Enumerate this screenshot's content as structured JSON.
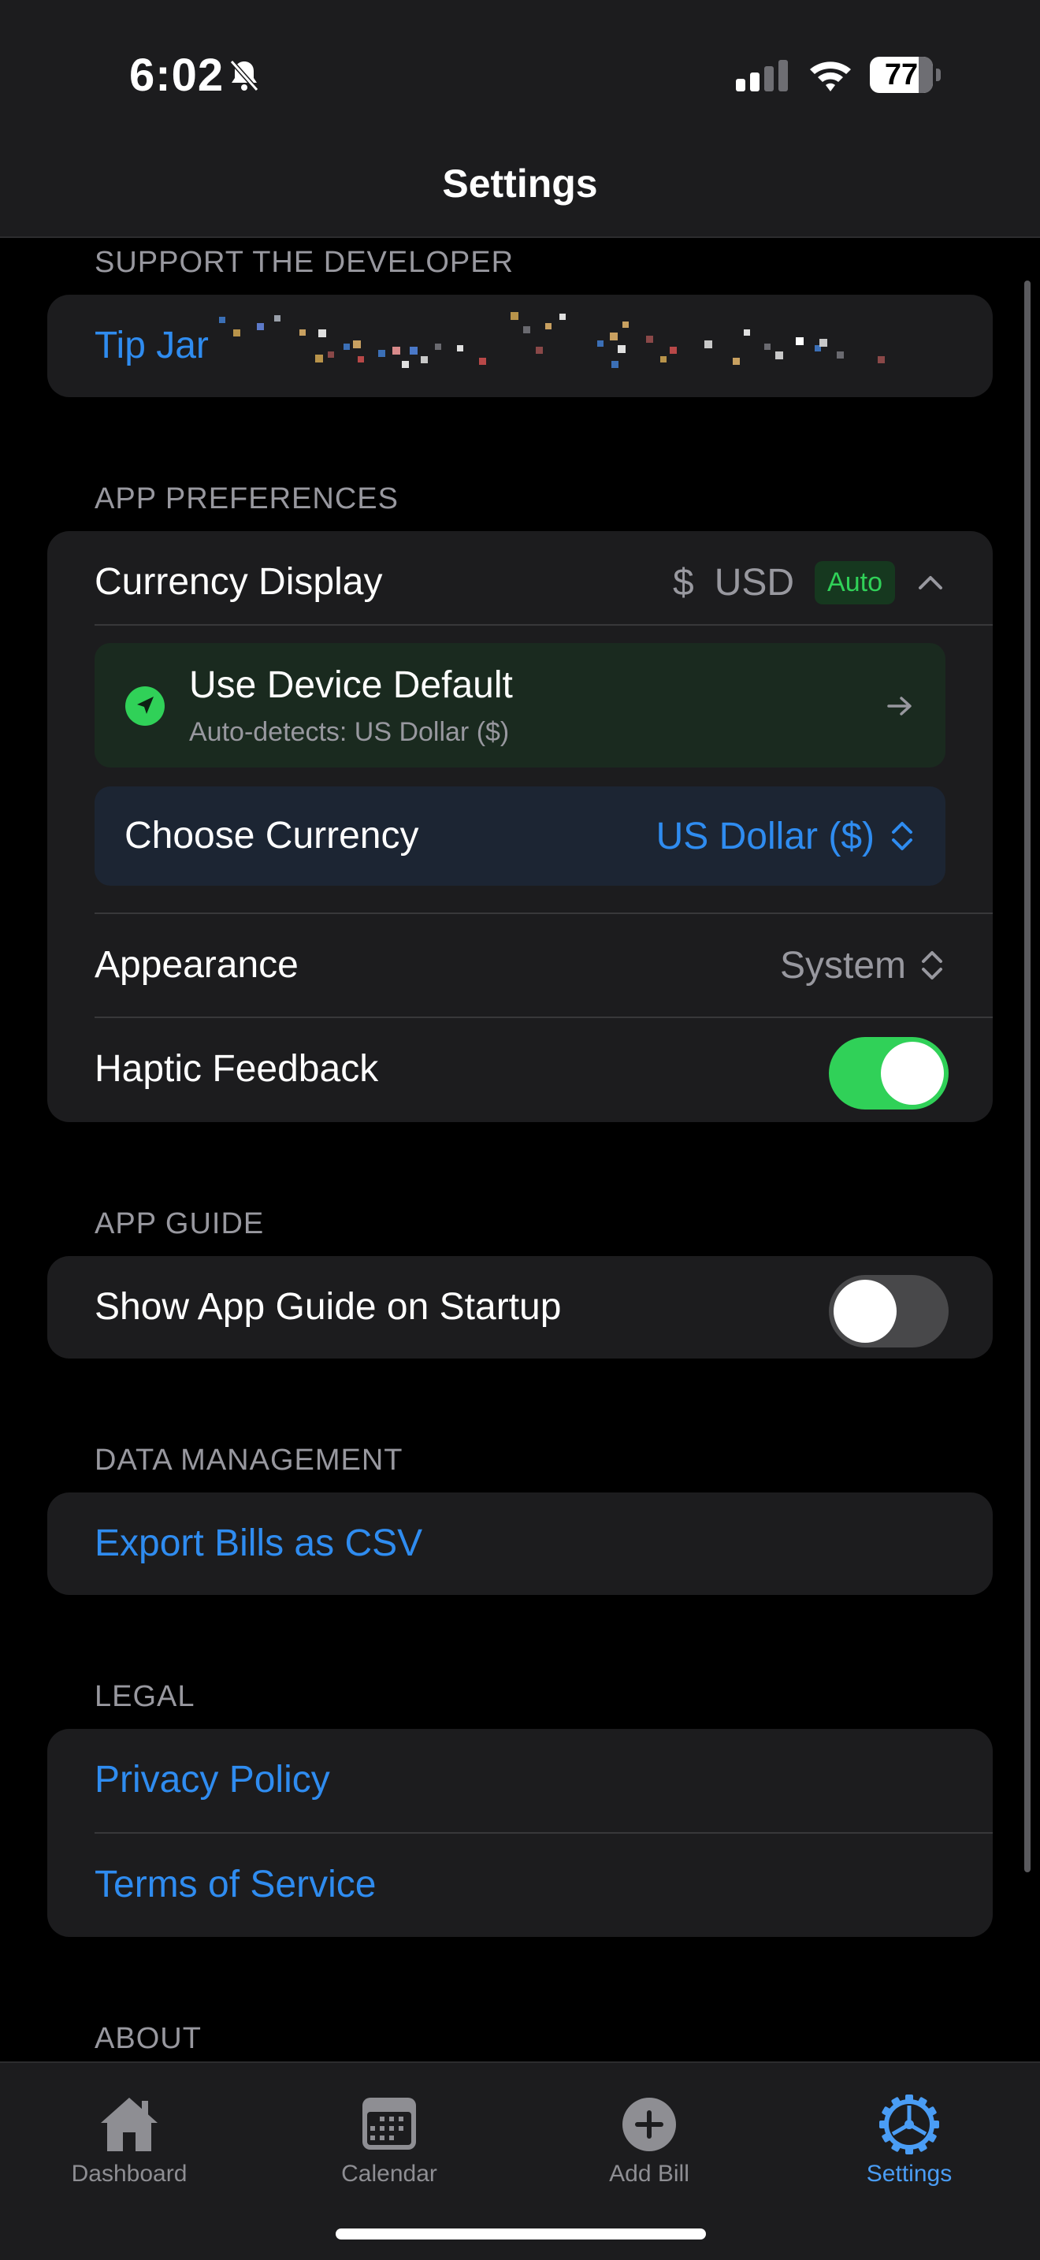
{
  "status_bar": {
    "time": "6:02",
    "battery_level": "77"
  },
  "nav": {
    "title": "Settings"
  },
  "sections": {
    "support": {
      "header": "SUPPORT THE DEVELOPER",
      "tip_jar_label": "Tip Jar"
    },
    "preferences": {
      "header": "APP PREFERENCES",
      "currency_display_label": "Currency Display",
      "currency_symbol": "$",
      "currency_code": "USD",
      "auto_badge": "Auto",
      "device_default_title": "Use Device Default",
      "device_default_subtitle": "Auto-detects: US Dollar ($)",
      "choose_currency_label": "Choose Currency",
      "choose_currency_value": "US Dollar ($)",
      "appearance_label": "Appearance",
      "appearance_value": "System",
      "haptic_label": "Haptic Feedback",
      "haptic_on": true
    },
    "guide": {
      "header": "APP GUIDE",
      "show_guide_label": "Show App Guide on Startup",
      "show_guide_on": false
    },
    "data": {
      "header": "DATA MANAGEMENT",
      "export_label": "Export Bills as CSV"
    },
    "legal": {
      "header": "LEGAL",
      "privacy_label": "Privacy Policy",
      "terms_label": "Terms of Service"
    },
    "about": {
      "header": "ABOUT"
    }
  },
  "tab_bar": {
    "tabs": [
      {
        "label": "Dashboard",
        "icon": "house-icon",
        "active": false
      },
      {
        "label": "Calendar",
        "icon": "calendar-icon",
        "active": false
      },
      {
        "label": "Add Bill",
        "icon": "plus-circle-icon",
        "active": false
      },
      {
        "label": "Settings",
        "icon": "gear-icon",
        "active": true
      }
    ]
  },
  "colors": {
    "accent_blue": "#2f8cf0",
    "toggle_green": "#30d158",
    "background": "#000000",
    "group_background": "#1c1c1e"
  }
}
